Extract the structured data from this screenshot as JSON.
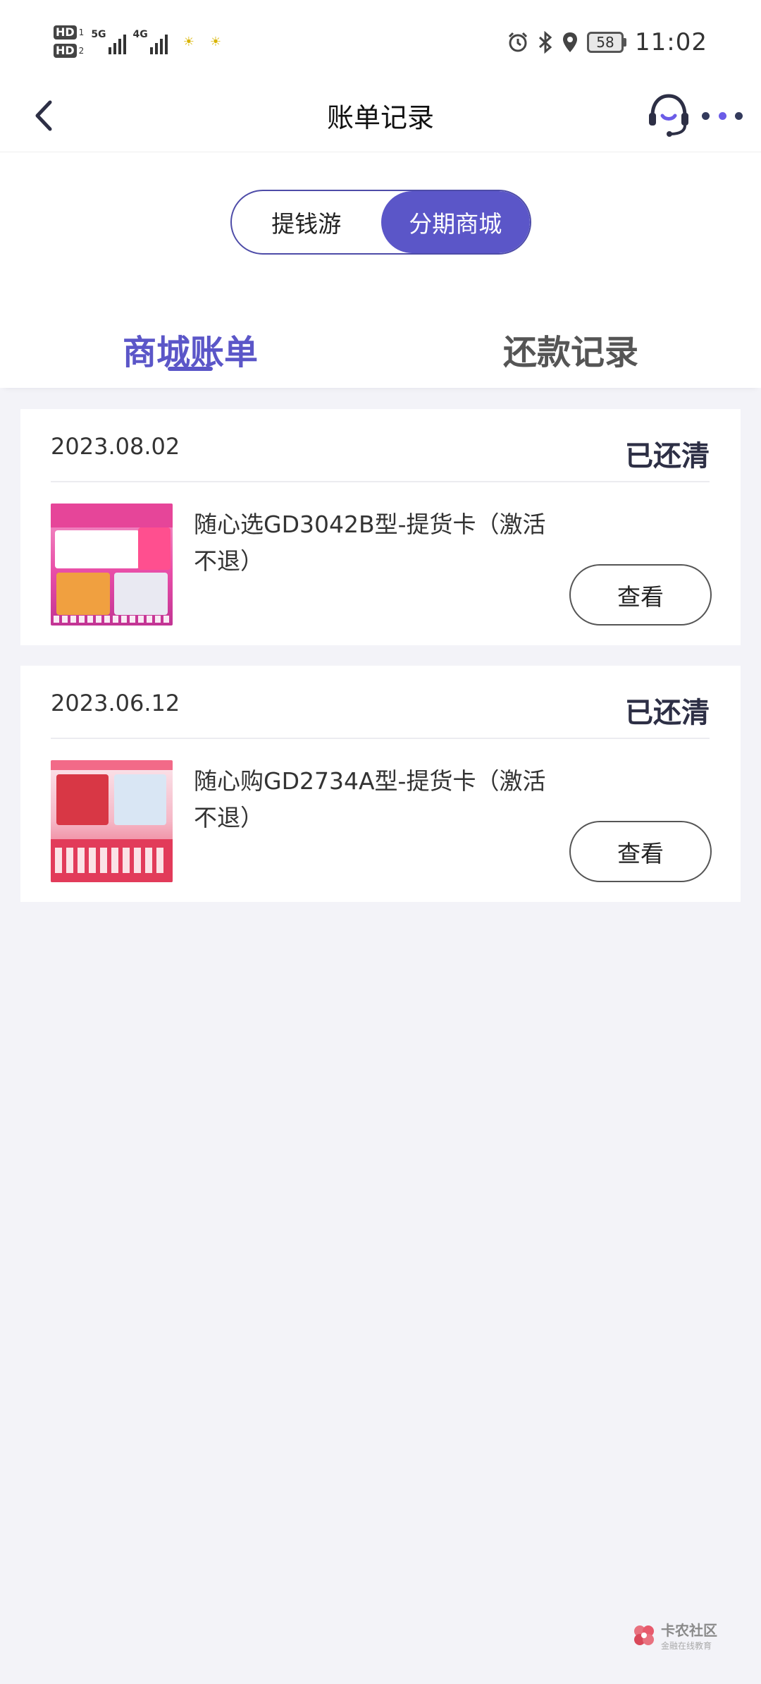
{
  "status_bar": {
    "hd1": "HD",
    "hd1_num": "1",
    "hd2": "HD",
    "hd2_num": "2",
    "sig1": "5G",
    "sig2": "4G",
    "battery": "58",
    "time": "11:02"
  },
  "nav": {
    "title": "账单记录"
  },
  "toggle": {
    "options": [
      "提钱游",
      "分期商城"
    ],
    "selected": "分期商城"
  },
  "tabs": {
    "items": [
      "商城账单",
      "还款记录"
    ],
    "active": "商城账单"
  },
  "bills": [
    {
      "date": "2023.08.02",
      "status": "已还清",
      "product": "随心选GD3042B型-提货卡（激活不退）",
      "button": "查看"
    },
    {
      "date": "2023.06.12",
      "status": "已还清",
      "product": "随心购GD2734A型-提货卡（激活不退）",
      "button": "查看"
    }
  ],
  "watermark": {
    "title": "卡农社区",
    "subtitle": "金融在线教育"
  },
  "colors": {
    "accent": "#5b56c8",
    "background": "#f3f3f8",
    "status_text": "#2d2f45"
  }
}
